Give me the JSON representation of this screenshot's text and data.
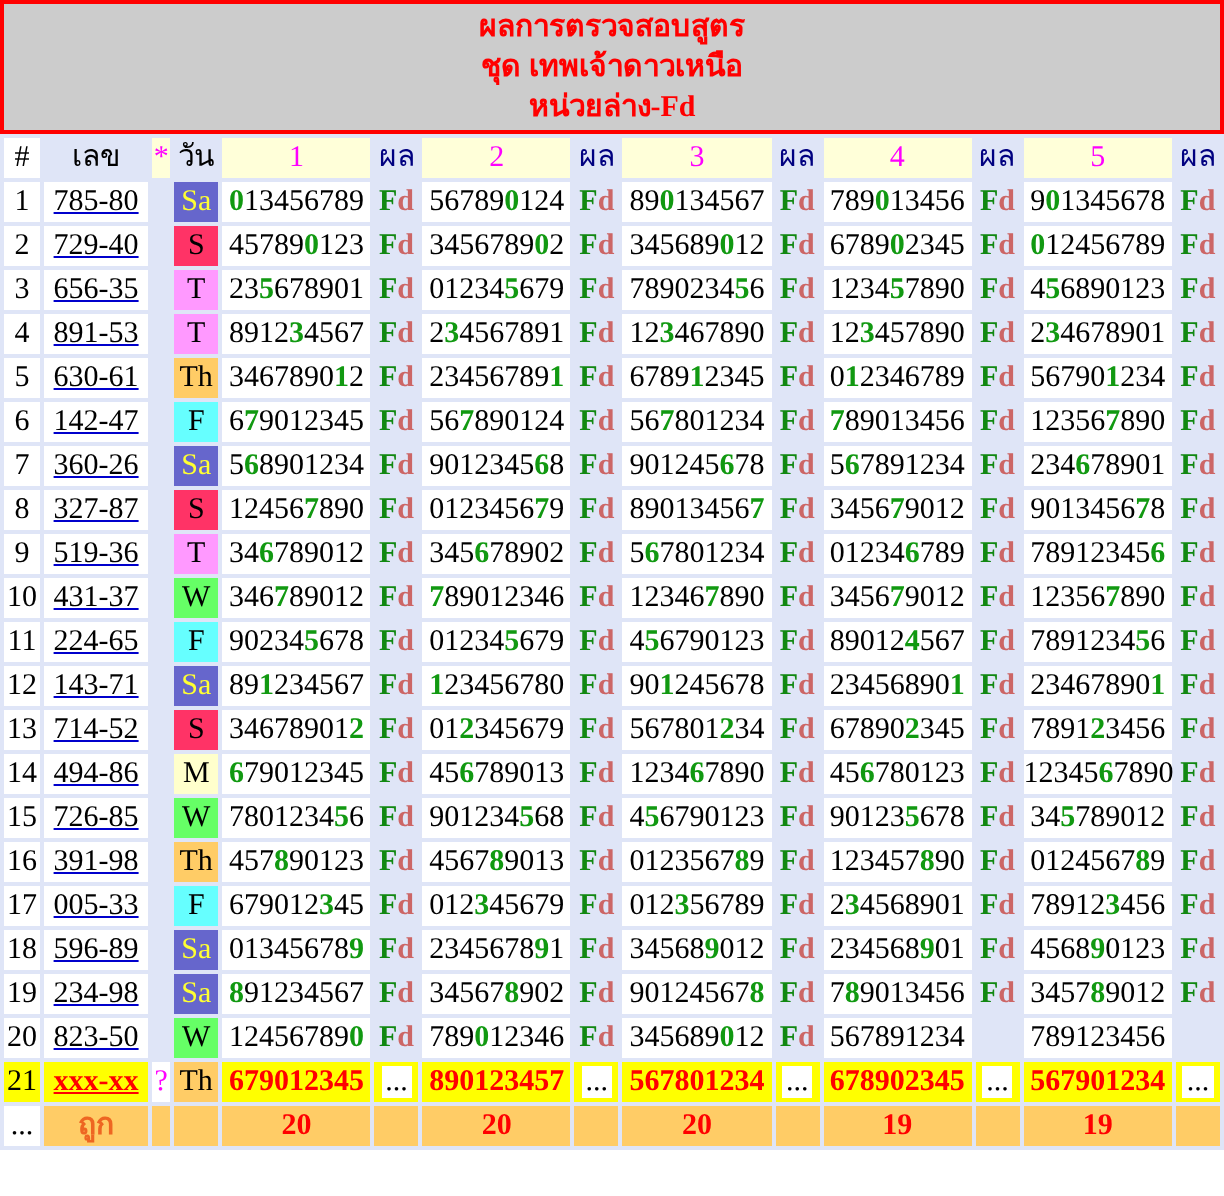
{
  "title": [
    "ผลการตรวจสอบสูตร",
    "ชุด เทพเจ้าดาวเหนือ",
    "หน่วยล่าง-Fd"
  ],
  "header": {
    "index": "#",
    "number": "เลข",
    "marker": "*",
    "day": "วัน",
    "columns": [
      {
        "label": "1",
        "result": "ผล"
      },
      {
        "label": "2",
        "result": "ผล"
      },
      {
        "label": "3",
        "result": "ผล"
      },
      {
        "label": "4",
        "result": "ผล"
      },
      {
        "label": "5",
        "result": "ผล"
      }
    ]
  },
  "rows": [
    {
      "kind": "draw",
      "index": "1",
      "number": "785-80",
      "day": "Sa",
      "color": "#6666cc",
      "cells": [
        {
          "value": "**0**13456789",
          "result": "Fd"
        },
        {
          "value": "56789**0**124",
          "result": "Fd"
        },
        {
          "value": "89**0**134567",
          "result": "Fd"
        },
        {
          "value": "789**0**13456",
          "result": "Fd"
        },
        {
          "value": "9**0**1345678",
          "result": "Fd"
        }
      ]
    },
    {
      "kind": "draw",
      "index": "2",
      "number": "729-40",
      "day": "S",
      "color": "#ff3366",
      "cells": [
        {
          "value": "45789**0**123",
          "result": "Fd"
        },
        {
          "value": "3456789**0**2",
          "result": "Fd"
        },
        {
          "value": "345689**0**12",
          "result": "Fd"
        },
        {
          "value": "6789**0**2345",
          "result": "Fd"
        },
        {
          "value": "**0**12456789",
          "result": "Fd"
        }
      ]
    },
    {
      "kind": "draw",
      "index": "3",
      "number": "656-35",
      "day": "T",
      "color": "#ff99ff",
      "cells": [
        {
          "value": "23**5**678901",
          "result": "Fd"
        },
        {
          "value": "01234**5**679",
          "result": "Fd"
        },
        {
          "value": "7890234**5**6",
          "result": "Fd"
        },
        {
          "value": "1234**5**7890",
          "result": "Fd"
        },
        {
          "value": "4**5**6890123",
          "result": "Fd"
        }
      ]
    },
    {
      "kind": "draw",
      "index": "4",
      "number": "891-53",
      "day": "T",
      "color": "#ff99ff",
      "cells": [
        {
          "value": "8912**3**4567",
          "result": "Fd"
        },
        {
          "value": "2**3**4567891",
          "result": "Fd"
        },
        {
          "value": "12**3**467890",
          "result": "Fd"
        },
        {
          "value": "12**3**457890",
          "result": "Fd"
        },
        {
          "value": "2**3**4678901",
          "result": "Fd"
        }
      ]
    },
    {
      "kind": "draw",
      "index": "5",
      "number": "630-61",
      "day": "Th",
      "color": "#ffcc66",
      "cells": [
        {
          "value": "3467890**1**2",
          "result": "Fd"
        },
        {
          "value": "23456789**1**",
          "result": "Fd"
        },
        {
          "value": "6789**1**2345",
          "result": "Fd"
        },
        {
          "value": "0**1**2346789",
          "result": "Fd"
        },
        {
          "value": "56790**1**234",
          "result": "Fd"
        }
      ]
    },
    {
      "kind": "draw",
      "index": "6",
      "number": "142-47",
      "day": "F",
      "color": "#66ffff",
      "cells": [
        {
          "value": "6**7**9012345",
          "result": "Fd"
        },
        {
          "value": "56**7**890124",
          "result": "Fd"
        },
        {
          "value": "56**7**801234",
          "result": "Fd"
        },
        {
          "value": "**7**89013456",
          "result": "Fd"
        },
        {
          "value": "12356**7**890",
          "result": "Fd"
        }
      ]
    },
    {
      "kind": "draw",
      "index": "7",
      "number": "360-26",
      "day": "Sa",
      "color": "#6666cc",
      "cells": [
        {
          "value": "5**6**8901234",
          "result": "Fd"
        },
        {
          "value": "9012345**6**8",
          "result": "Fd"
        },
        {
          "value": "901245**6**78",
          "result": "Fd"
        },
        {
          "value": "5**6**7891234",
          "result": "Fd"
        },
        {
          "value": "234**6**78901",
          "result": "Fd"
        }
      ]
    },
    {
      "kind": "draw",
      "index": "8",
      "number": "327-87",
      "day": "S",
      "color": "#ff3366",
      "cells": [
        {
          "value": "12456**7**890",
          "result": "Fd"
        },
        {
          "value": "0123456**7**9",
          "result": "Fd"
        },
        {
          "value": "89013456**7**",
          "result": "Fd"
        },
        {
          "value": "3456**7**9012",
          "result": "Fd"
        },
        {
          "value": "9013456**7**8",
          "result": "Fd"
        }
      ]
    },
    {
      "kind": "draw",
      "index": "9",
      "number": "519-36",
      "day": "T",
      "color": "#ff99ff",
      "cells": [
        {
          "value": "34**6**789012",
          "result": "Fd"
        },
        {
          "value": "345**6**78902",
          "result": "Fd"
        },
        {
          "value": "5**6**7801234",
          "result": "Fd"
        },
        {
          "value": "01234**6**789",
          "result": "Fd"
        },
        {
          "value": "78912345**6**",
          "result": "Fd"
        }
      ]
    },
    {
      "kind": "draw",
      "index": "10",
      "number": "431-37",
      "day": "W",
      "color": "#66ff66",
      "cells": [
        {
          "value": "346**7**89012",
          "result": "Fd"
        },
        {
          "value": "**7**89012346",
          "result": "Fd"
        },
        {
          "value": "12346**7**890",
          "result": "Fd"
        },
        {
          "value": "3456**7**9012",
          "result": "Fd"
        },
        {
          "value": "12356**7**890",
          "result": "Fd"
        }
      ]
    },
    {
      "kind": "draw",
      "index": "11",
      "number": "224-65",
      "day": "F",
      "color": "#66ffff",
      "cells": [
        {
          "value": "90234**5**678",
          "result": "Fd"
        },
        {
          "value": "01234**5**679",
          "result": "Fd"
        },
        {
          "value": "4**5**6790123",
          "result": "Fd"
        },
        {
          "value": "89012**4**567",
          "result": "Fd"
        },
        {
          "value": "7891234**5**6",
          "result": "Fd"
        }
      ]
    },
    {
      "kind": "draw",
      "index": "12",
      "number": "143-71",
      "day": "Sa",
      "color": "#6666cc",
      "cells": [
        {
          "value": "89**1**234567",
          "result": "Fd"
        },
        {
          "value": "**1**23456780",
          "result": "Fd"
        },
        {
          "value": "90**1**245678",
          "result": "Fd"
        },
        {
          "value": "23456890**1**",
          "result": "Fd"
        },
        {
          "value": "23467890**1**",
          "result": "Fd"
        }
      ]
    },
    {
      "kind": "draw",
      "index": "13",
      "number": "714-52",
      "day": "S",
      "color": "#ff3366",
      "cells": [
        {
          "value": "34678901**2**",
          "result": "Fd"
        },
        {
          "value": "01**2**345679",
          "result": "Fd"
        },
        {
          "value": "567801**2**34",
          "result": "Fd"
        },
        {
          "value": "67890**2**345",
          "result": "Fd"
        },
        {
          "value": "7891**2**3456",
          "result": "Fd"
        }
      ]
    },
    {
      "kind": "draw",
      "index": "14",
      "number": "494-86",
      "day": "M",
      "color": "#ffffcc",
      "cells": [
        {
          "value": "**6**79012345",
          "result": "Fd"
        },
        {
          "value": "45**6**789013",
          "result": "Fd"
        },
        {
          "value": "1234**6**7890",
          "result": "Fd"
        },
        {
          "value": "45**6**780123",
          "result": "Fd"
        },
        {
          "value": "12345**6**7890",
          "result": "Fd"
        }
      ]
    },
    {
      "kind": "draw",
      "index": "15",
      "number": "726-85",
      "day": "W",
      "color": "#66ff66",
      "cells": [
        {
          "value": "7801234**5**6",
          "result": "Fd"
        },
        {
          "value": "901234**5**68",
          "result": "Fd"
        },
        {
          "value": "4**5**6790123",
          "result": "Fd"
        },
        {
          "value": "90123**5**678",
          "result": "Fd"
        },
        {
          "value": "34**5**789012",
          "result": "Fd"
        }
      ]
    },
    {
      "kind": "draw",
      "index": "16",
      "number": "391-98",
      "day": "Th",
      "color": "#ffcc66",
      "cells": [
        {
          "value": "457**8**90123",
          "result": "Fd"
        },
        {
          "value": "4567**8**9013",
          "result": "Fd"
        },
        {
          "value": "0123567**8**9",
          "result": "Fd"
        },
        {
          "value": "123457**8**90",
          "result": "Fd"
        },
        {
          "value": "0124567**8**9",
          "result": "Fd"
        }
      ]
    },
    {
      "kind": "draw",
      "index": "17",
      "number": "005-33",
      "day": "F",
      "color": "#66ffff",
      "cells": [
        {
          "value": "679012**3**45",
          "result": "Fd"
        },
        {
          "value": "012**3**45679",
          "result": "Fd"
        },
        {
          "value": "012**3**56789",
          "result": "Fd"
        },
        {
          "value": "2**3**4568901",
          "result": "Fd"
        },
        {
          "value": "78912**3**456",
          "result": "Fd"
        }
      ]
    },
    {
      "kind": "draw",
      "index": "18",
      "number": "596-89",
      "day": "Sa",
      "color": "#6666cc",
      "cells": [
        {
          "value": "01345678**9**",
          "result": "Fd"
        },
        {
          "value": "2345678**9**1",
          "result": "Fd"
        },
        {
          "value": "34568**9**012",
          "result": "Fd"
        },
        {
          "value": "234568**9**01",
          "result": "Fd"
        },
        {
          "value": "4568**9**0123",
          "result": "Fd"
        }
      ]
    },
    {
      "kind": "draw",
      "index": "19",
      "number": "234-98",
      "day": "Sa",
      "color": "#6666cc",
      "cells": [
        {
          "value": "**8**91234567",
          "result": "Fd"
        },
        {
          "value": "34567**8**902",
          "result": "Fd"
        },
        {
          "value": "90124567**8**",
          "result": "Fd"
        },
        {
          "value": "7**8**9013456",
          "result": "Fd"
        },
        {
          "value": "3457**8**9012",
          "result": "Fd"
        }
      ]
    },
    {
      "kind": "draw",
      "index": "20",
      "number": "823-50",
      "day": "W",
      "color": "#66ff66",
      "cells": [
        {
          "value": "12456789**0**",
          "result": "Fd"
        },
        {
          "value": "789**0**12346",
          "result": "Fd"
        },
        {
          "value": "345689**0**12",
          "result": "Fd"
        },
        {
          "value": "567891234"
        },
        {
          "value": "789123456"
        }
      ]
    },
    {
      "kind": "pending",
      "index": "21",
      "number": "xxx-xx",
      "marker": "?",
      "day": "Th",
      "color": "#ffcc66",
      "cells": [
        {
          "value": "679012345",
          "result": "..."
        },
        {
          "value": "890123457",
          "result": "..."
        },
        {
          "value": "567801234",
          "result": "..."
        },
        {
          "value": "678902345",
          "result": "..."
        },
        {
          "value": "567901234",
          "result": "..."
        }
      ]
    }
  ],
  "footer": {
    "index": "...",
    "label": "ถูก",
    "counts": [
      "20",
      "20",
      "20",
      "19",
      "19"
    ]
  }
}
